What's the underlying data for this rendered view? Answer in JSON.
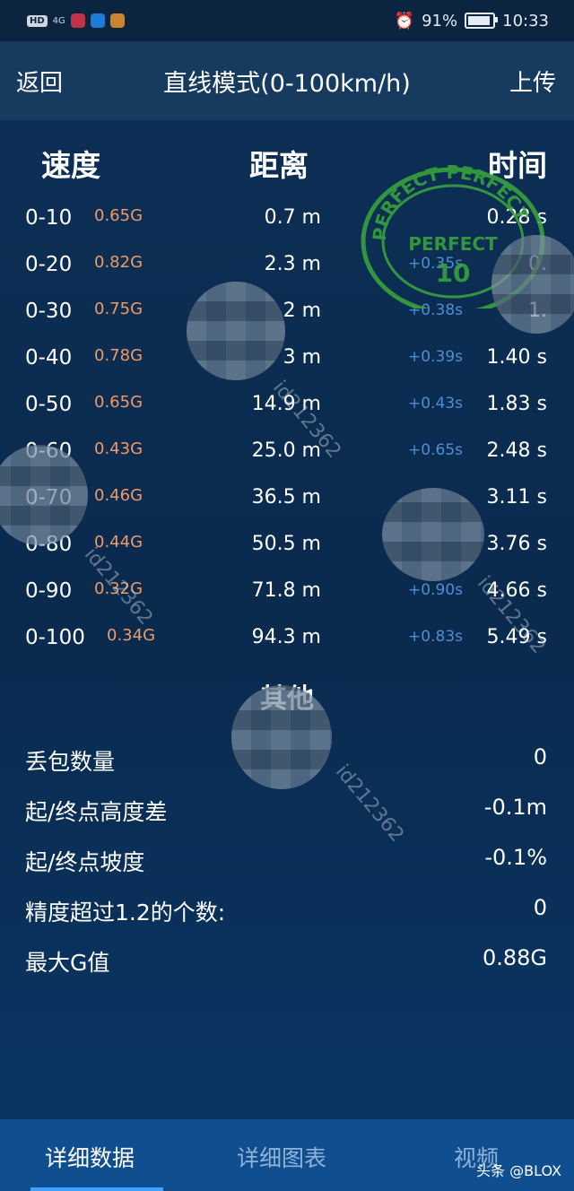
{
  "status_bar": {
    "hd_badge": "HD",
    "network": "4G",
    "battery_text": "91%",
    "battery_level": 0.91,
    "time": "10:33"
  },
  "nav": {
    "back_label": "返回",
    "title": "直线模式(0-100km/h)",
    "upload_label": "上传"
  },
  "table": {
    "headers": {
      "speed": "速度",
      "distance": "距离",
      "time": "时间"
    },
    "rows": [
      {
        "range": "0-10",
        "g": "0.65G",
        "distance": "0.7 m",
        "delta": "",
        "time": "0.28 s"
      },
      {
        "range": "0-20",
        "g": "0.82G",
        "distance": "2.3 m",
        "delta": "+0.35s",
        "time": "0."
      },
      {
        "range": "0-30",
        "g": "0.75G",
        "distance": "2 m",
        "delta": "+0.38s",
        "time": "1."
      },
      {
        "range": "0-40",
        "g": "0.78G",
        "distance": "3 m",
        "delta": "+0.39s",
        "time": "1.40 s"
      },
      {
        "range": "0-50",
        "g": "0.65G",
        "distance": "14.9 m",
        "delta": "+0.43s",
        "time": "1.83 s"
      },
      {
        "range": "0-60",
        "g": "0.43G",
        "distance": "25.0 m",
        "delta": "+0.65s",
        "time": "2.48 s"
      },
      {
        "range": "0-70",
        "g": "0.46G",
        "distance": "36.5 m",
        "delta": "",
        "time": "3.11 s"
      },
      {
        "range": "0-80",
        "g": "0.44G",
        "distance": "50.5 m",
        "delta": "",
        "time": "3.76 s"
      },
      {
        "range": "0-90",
        "g": "0.32G",
        "distance": "71.8 m",
        "delta": "+0.90s",
        "time": "4.66 s"
      },
      {
        "range": "0-100",
        "g": "0.34G",
        "distance": "94.3 m",
        "delta": "+0.83s",
        "time": "5.49 s"
      }
    ]
  },
  "other": {
    "title": "其他",
    "stats": [
      {
        "label": "丢包数量",
        "value": "0"
      },
      {
        "label": "起/终点高度差",
        "value": "-0.1m"
      },
      {
        "label": "起/终点坡度",
        "value": "-0.1%"
      },
      {
        "label": "精度超过1.2的个数:",
        "value": "0"
      },
      {
        "label": "最大G值",
        "value": "0.88G"
      }
    ]
  },
  "stamp": {
    "text_top": "PERFECT PERFECT",
    "text_mid": "PERFECT",
    "number": "10"
  },
  "watermark_text": "id212362",
  "tabs": {
    "detail_data": "详细数据",
    "detail_chart": "详细图表",
    "video": "视频",
    "active": "detail_data"
  },
  "credit": "头条 @BLOX"
}
